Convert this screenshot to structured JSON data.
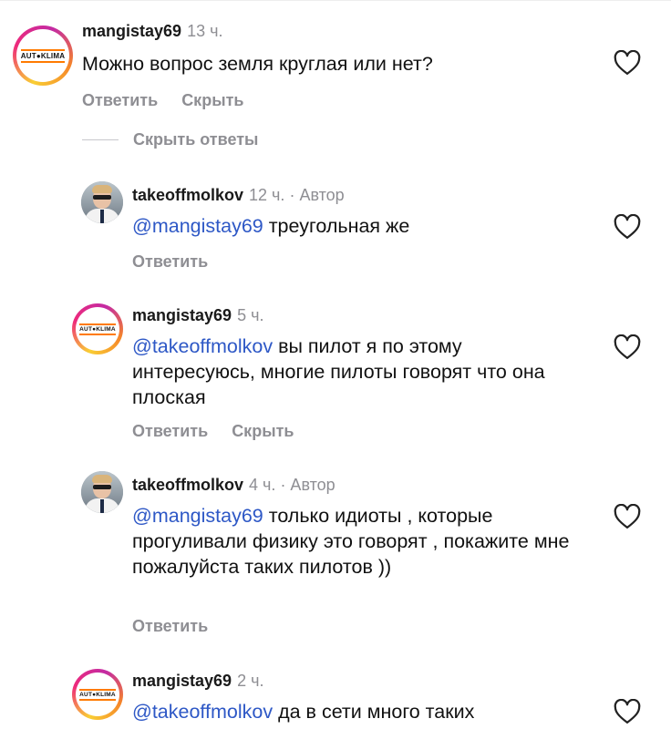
{
  "comments": [
    {
      "user": "mangistay69",
      "time": "13 ч.",
      "author_tag": "",
      "mention": "",
      "text": "Можно вопрос земля круглая или нет?",
      "reply_label": "Ответить",
      "hide_label": "Скрыть",
      "avatar": "AUT●KLIMA"
    },
    {
      "user": "takeoffmolkov",
      "time": "12 ч.",
      "author_tag": "· Автор",
      "mention": "@mangistay69",
      "text": " треугольная же",
      "reply_label": "Ответить",
      "hide_label": ""
    },
    {
      "user": "mangistay69",
      "time": "5 ч.",
      "author_tag": "",
      "mention": "@takeoffmolkov",
      "text": " вы пилот я по этому интересуюсь, многие пилоты говорят что она плоская",
      "reply_label": "Ответить",
      "hide_label": "Скрыть",
      "avatar": "AUT●KLIMA"
    },
    {
      "user": "takeoffmolkov",
      "time": "4 ч.",
      "author_tag": "· Автор",
      "mention": "@mangistay69",
      "text": " только идиоты , которые прогуливали физику это говорят , покажите мне пожалуйста таких пилотов ))",
      "reply_label": "Ответить",
      "hide_label": ""
    },
    {
      "user": "mangistay69",
      "time": "2 ч.",
      "author_tag": "",
      "mention": "@takeoffmolkov",
      "text": " да в сети много таких",
      "reply_label": "",
      "hide_label": "",
      "avatar": "AUT●KLIMA"
    }
  ],
  "hide_replies_label": "Скрыть ответы",
  "colors": {
    "mention": "#2e58c6",
    "secondary": "#8e8e93"
  },
  "icons": {
    "like": "heart-outline-icon"
  }
}
